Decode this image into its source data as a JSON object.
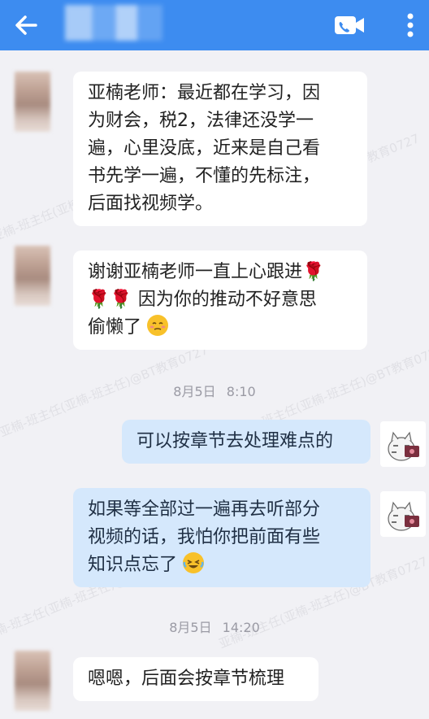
{
  "header": {
    "back_icon": "arrow-left-icon",
    "video_icon": "video-call-icon",
    "more_icon": "more-vertical-icon",
    "accent": "#3d8cf0"
  },
  "messages": [
    {
      "side": "left",
      "lines": [
        "亚楠老师：最近都在学习，因",
        "为财会，税2，法律还没学一",
        "遍，心里没底，近来是自己看",
        "书先学一遍，不懂的先标注，",
        "后面找视频学。"
      ]
    },
    {
      "side": "left",
      "line1": "谢谢亚楠老师一直上心跟进",
      "flower": "🌹",
      "line2": "因为你的推动不好意思",
      "line3": "偷懒了"
    },
    {
      "type": "timestamp",
      "date": "8月5日",
      "time": "8:10"
    },
    {
      "side": "right",
      "text": "可以按章节去处理难点的"
    },
    {
      "side": "right",
      "lines": [
        "如果等全部过一遍再去听部分",
        "视频的话，我怕你把前面有些",
        "知识点忘了"
      ]
    },
    {
      "type": "timestamp",
      "date": "8月5日",
      "time": "14:20"
    },
    {
      "side": "left",
      "text": "嗯嗯，后面会按章节梳理"
    }
  ],
  "watermark_text": "亚楠-班主任(亚楠-班主任)@BT教育0727"
}
